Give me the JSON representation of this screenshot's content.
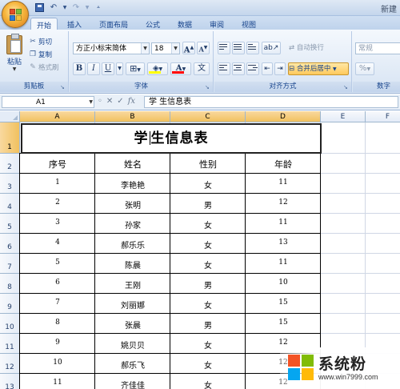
{
  "window": {
    "title": "新建",
    "quick_access": {
      "save_icon": "save-icon",
      "undo_icon": "undo-icon",
      "redo_icon": "redo-icon",
      "customize_icon": "qat-dropdown-icon"
    }
  },
  "ribbon_tabs": [
    "开始",
    "插入",
    "页面布局",
    "公式",
    "数据",
    "审阅",
    "视图"
  ],
  "active_tab": "开始",
  "clipboard_group": {
    "label": "剪贴板",
    "paste_label": "粘贴",
    "cut_label": "剪切",
    "copy_label": "复制",
    "format_painter_label": "格式刷"
  },
  "font_group": {
    "label": "字体",
    "font_name": "方正小标宋简体",
    "font_size": "18",
    "grow_label": "A",
    "shrink_label": "A",
    "bold_label": "B",
    "italic_label": "I",
    "underline_label": "U",
    "fill_color": "#ffff00",
    "font_color": "#ff0000"
  },
  "alignment_group": {
    "label": "对齐方式",
    "wrap_text_label": "自动换行",
    "merge_center_label": "合并后居中"
  },
  "number_group": {
    "label": "数字",
    "format_value": "常规",
    "percent_label": "%"
  },
  "formula_bar": {
    "name_box": "A1",
    "fx_label": "fx",
    "content": "学  生信息表"
  },
  "columns": [
    "A",
    "B",
    "C",
    "D",
    "E",
    "F"
  ],
  "rows": [
    "1",
    "2",
    "3",
    "4",
    "5",
    "6",
    "7",
    "8",
    "9",
    "10",
    "11",
    "12",
    "13"
  ],
  "sheet": {
    "title_left": "学",
    "title_right": "生信息表",
    "headers": [
      "序号",
      "姓名",
      "性别",
      "年龄"
    ],
    "records": [
      [
        "1",
        "李艳艳",
        "女",
        "11"
      ],
      [
        "2",
        "张明",
        "男",
        "12"
      ],
      [
        "3",
        "孙家",
        "女",
        "11"
      ],
      [
        "4",
        "郝乐乐",
        "女",
        "13"
      ],
      [
        "5",
        "陈晨",
        "女",
        "11"
      ],
      [
        "6",
        "王刚",
        "男",
        "10"
      ],
      [
        "7",
        "刘丽娜",
        "女",
        "15"
      ],
      [
        "8",
        "张晨",
        "男",
        "15"
      ],
      [
        "9",
        "姚贝贝",
        "女",
        "12"
      ],
      [
        "10",
        "郝乐飞",
        "女",
        "12"
      ],
      [
        "11",
        "齐佳佳",
        "女",
        "12"
      ]
    ]
  },
  "watermark": {
    "brand": "系统粉",
    "url": "www.win7999.com"
  },
  "colors": {
    "selection_header": "#f1c15f",
    "ribbon_text": "#15428b",
    "win_red": "#f35325",
    "win_green": "#81bc06",
    "win_blue": "#05a6f0",
    "win_yellow": "#ffba08"
  }
}
